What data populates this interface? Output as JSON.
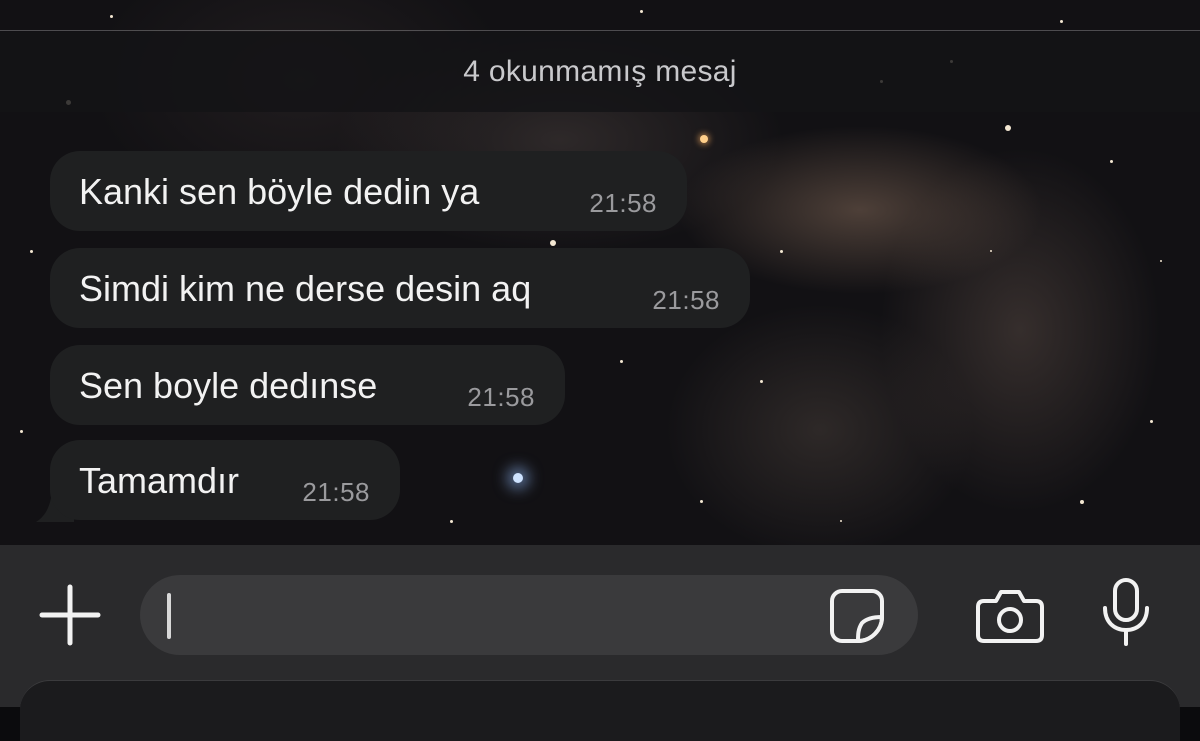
{
  "unread_banner": {
    "text": "4 okunmamış mesaj"
  },
  "messages": [
    {
      "text": "Kanki sen böyle dedin ya",
      "time": "21:58"
    },
    {
      "text": "Simdi kim ne derse desin aq",
      "time": "21:58"
    },
    {
      "text": "Sen boyle dedınse",
      "time": "21:58"
    },
    {
      "text": "Tamamdır",
      "time": "21:58"
    }
  ],
  "composer": {
    "value": "",
    "icons": [
      "plus-icon",
      "sticker-icon",
      "camera-icon",
      "microphone-icon"
    ]
  },
  "colors": {
    "bubble": "#1f2021",
    "banner": "#141416",
    "input_bar": "#2a2a2c",
    "text_field": "#3a3a3c",
    "timestamp": "#9a9a9d"
  }
}
